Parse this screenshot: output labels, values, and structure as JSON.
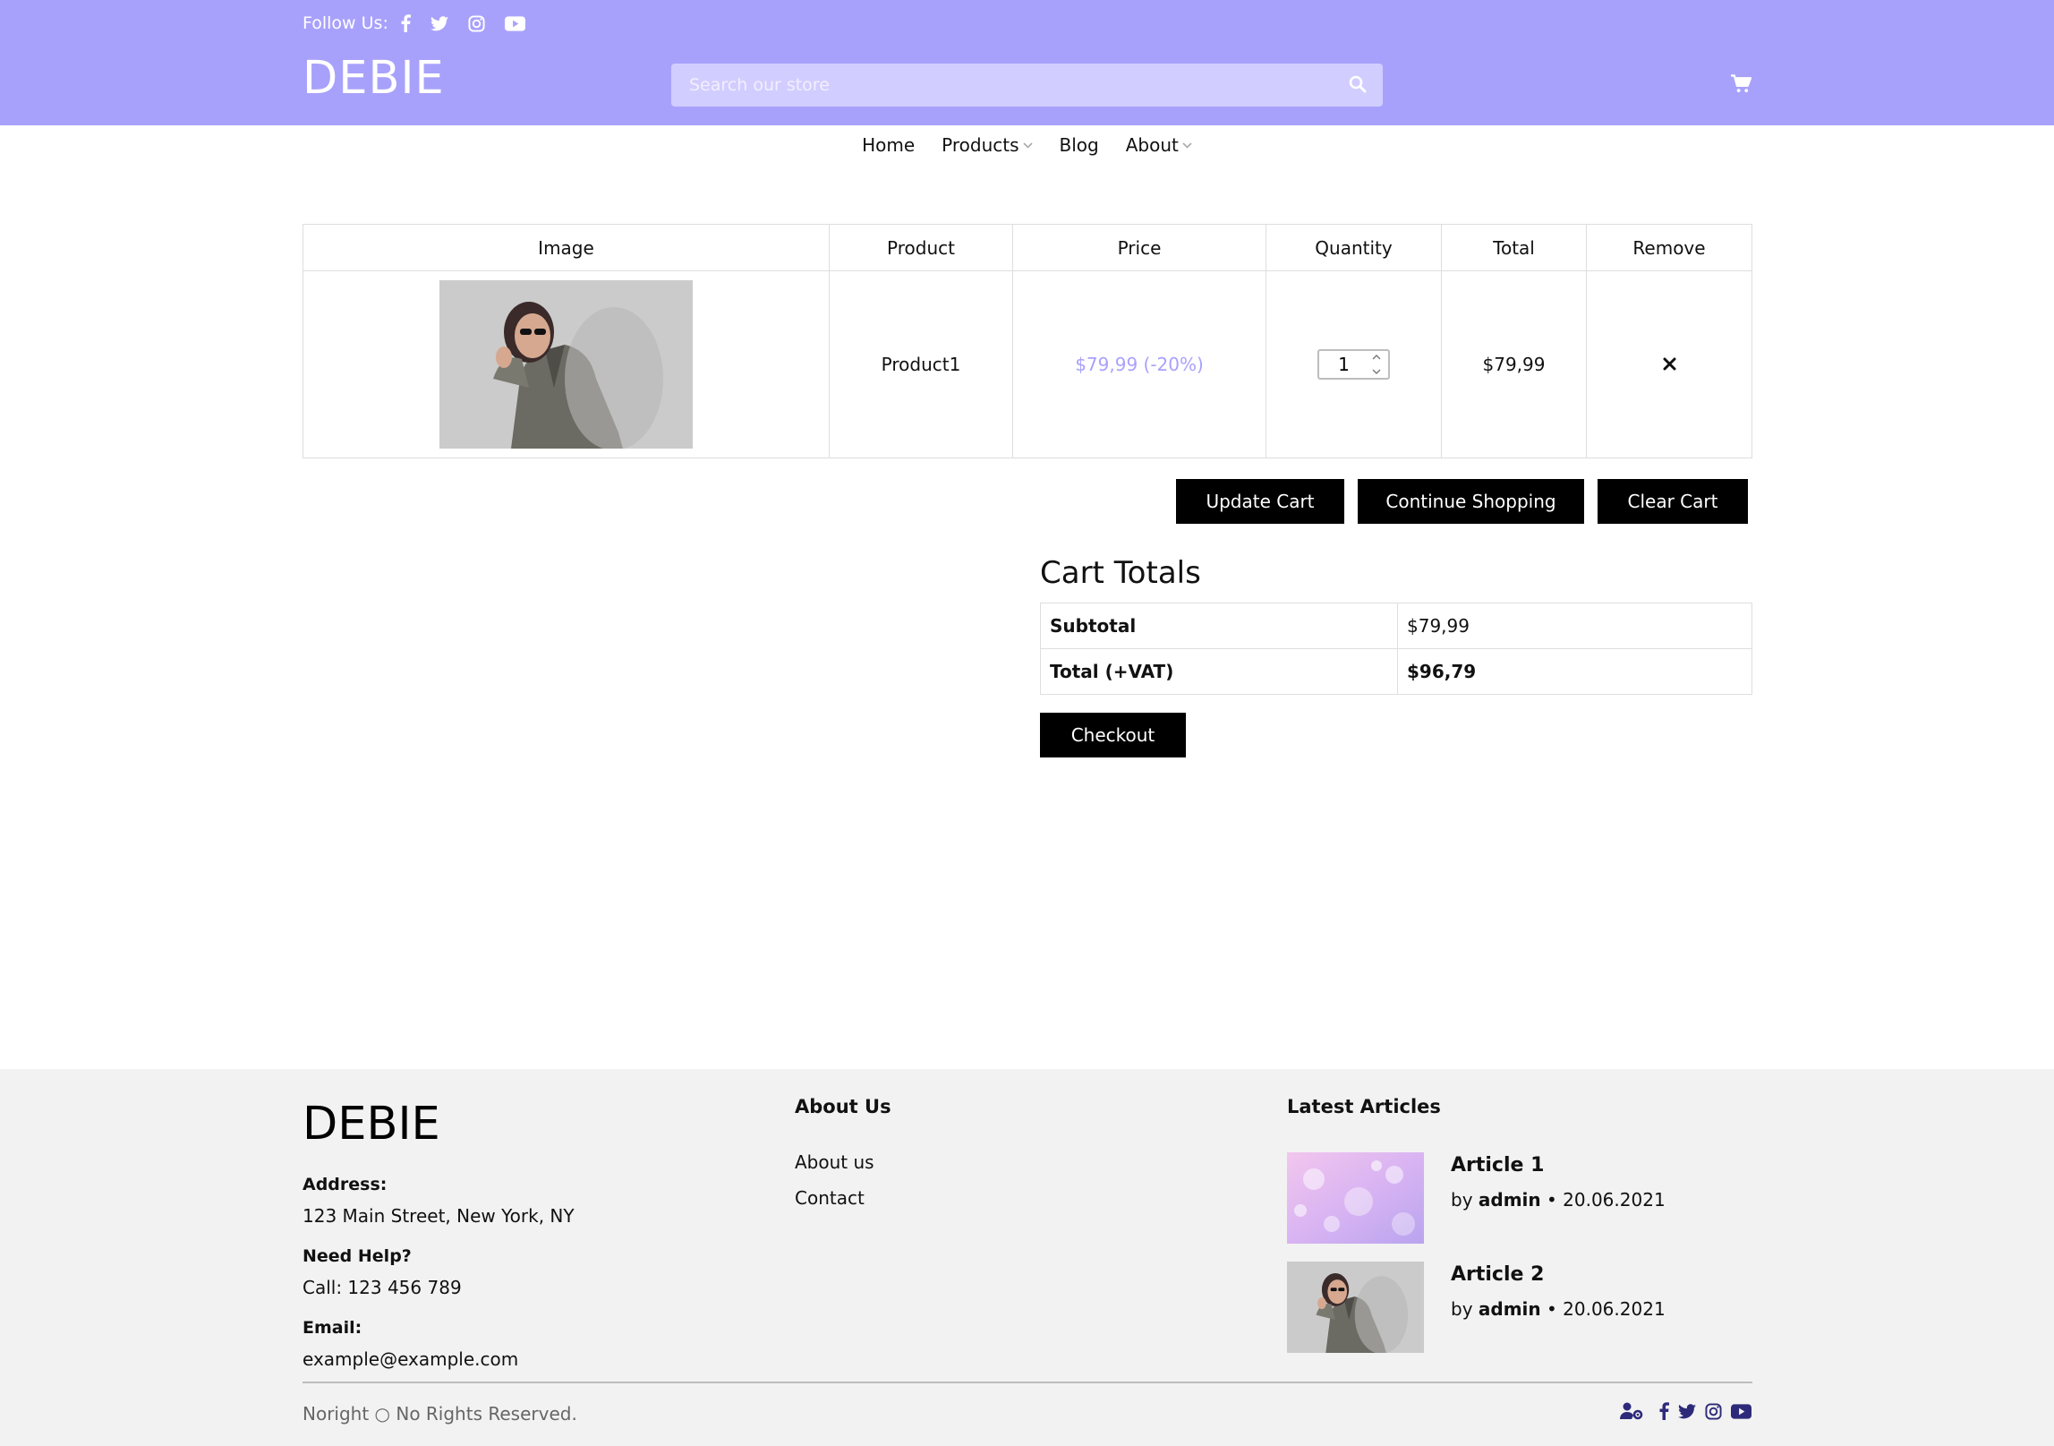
{
  "header": {
    "follow_label": "Follow Us:",
    "social_icons": [
      "facebook-icon",
      "twitter-icon",
      "instagram-icon",
      "youtube-icon"
    ],
    "logo": "DEBIE",
    "search_placeholder": "Search our store",
    "brand_color": "#a8a1fb"
  },
  "nav": {
    "items": [
      {
        "label": "Home"
      },
      {
        "label": "Products"
      },
      {
        "label": "Blog"
      },
      {
        "label": "About"
      }
    ]
  },
  "cart": {
    "columns": [
      "Image",
      "Product",
      "Price",
      "Quantity",
      "Total",
      "Remove"
    ],
    "rows": [
      {
        "product": "Product1",
        "price": "$79,99 (-20%)",
        "quantity": "1",
        "total": "$79,99"
      }
    ],
    "buttons": {
      "update": "Update Cart",
      "continue": "Continue Shopping",
      "clear": "Clear Cart"
    }
  },
  "totals": {
    "title": "Cart Totals",
    "subtotal_label": "Subtotal",
    "subtotal_value": "$79,99",
    "total_label": "Total (+VAT)",
    "total_value": "$96,79",
    "checkout": "Checkout"
  },
  "footer": {
    "logo": "DEBIE",
    "address_label": "Address:",
    "address": "123 Main Street, New York, NY",
    "help_label": "Need Help?",
    "help": "Call: 123 456 789",
    "email_label": "Email:",
    "email": "example@example.com",
    "about_heading": "About Us",
    "about_links": [
      "About us",
      "Contact"
    ],
    "articles_heading": "Latest Articles",
    "articles": [
      {
        "title": "Article 1",
        "by": "by",
        "author": "admin",
        "date": "• 20.06.2021"
      },
      {
        "title": "Article 2",
        "by": "by",
        "author": "admin",
        "date": "• 20.06.2021"
      }
    ],
    "copyright": "Noright ○ No Rights Reserved.",
    "icon_color": "#2d2a7a"
  }
}
